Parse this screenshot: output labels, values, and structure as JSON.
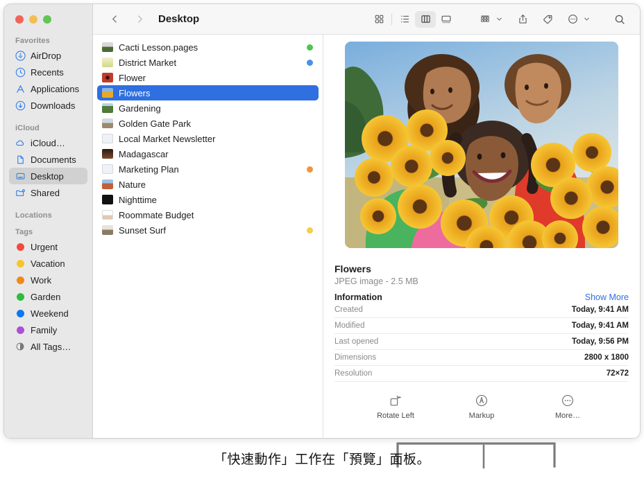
{
  "window": {
    "title": "Desktop",
    "traffic_lights": [
      "close-red",
      "minimize-yellow",
      "zoom-green"
    ]
  },
  "toolbar": {
    "back_icon": "chevron-left-icon",
    "forward_icon": "chevron-right-icon",
    "view_icon_grid": "icon-view-icon",
    "view_list": "list-view-icon",
    "view_columns": "column-view-icon",
    "view_gallery": "gallery-view-icon",
    "group_icon": "group-by-icon",
    "share_icon": "share-icon",
    "tag_icon": "tag-icon",
    "more_icon": "more-circle-icon",
    "search_icon": "search-icon",
    "active_view": "column-view-icon"
  },
  "sidebar": {
    "groups": [
      {
        "title": "Favorites",
        "items": [
          {
            "label": "AirDrop",
            "icon": "airdrop-icon"
          },
          {
            "label": "Recents",
            "icon": "clock-icon"
          },
          {
            "label": "Applications",
            "icon": "applications-icon"
          },
          {
            "label": "Downloads",
            "icon": "download-icon"
          }
        ]
      },
      {
        "title": "iCloud",
        "items": [
          {
            "label": "iCloud…",
            "icon": "cloud-icon"
          },
          {
            "label": "Documents",
            "icon": "document-icon"
          },
          {
            "label": "Desktop",
            "icon": "desktop-icon",
            "selected": true
          },
          {
            "label": "Shared",
            "icon": "shared-folder-icon"
          }
        ]
      },
      {
        "title": "Locations",
        "items": []
      },
      {
        "title": "Tags",
        "items": [
          {
            "label": "Urgent",
            "icon": "tag-dot-icon",
            "color": "#f5483f"
          },
          {
            "label": "Vacation",
            "icon": "tag-dot-icon",
            "color": "#f6c52c"
          },
          {
            "label": "Work",
            "icon": "tag-dot-icon",
            "color": "#f08a18"
          },
          {
            "label": "Garden",
            "icon": "tag-dot-icon",
            "color": "#2dbd3e"
          },
          {
            "label": "Weekend",
            "icon": "tag-dot-icon",
            "color": "#0b77f5"
          },
          {
            "label": "Family",
            "icon": "tag-dot-icon",
            "color": "#ad4fd6"
          },
          {
            "label": "All Tags…",
            "icon": "all-tags-icon",
            "color": ""
          }
        ]
      }
    ]
  },
  "filelist": {
    "items": [
      {
        "name": "Cacti Lesson.pages",
        "tag": "#49c84a",
        "selected": false
      },
      {
        "name": "District Market",
        "tag": "#4a90e8",
        "selected": false
      },
      {
        "name": "Flower",
        "tag": "",
        "selected": false
      },
      {
        "name": "Flowers",
        "tag": "",
        "selected": true
      },
      {
        "name": "Gardening",
        "tag": "",
        "selected": false
      },
      {
        "name": "Golden Gate Park",
        "tag": "",
        "selected": false
      },
      {
        "name": "Local Market Newsletter",
        "tag": "",
        "selected": false
      },
      {
        "name": "Madagascar",
        "tag": "",
        "selected": false
      },
      {
        "name": "Marketing Plan",
        "tag": "#f0953a",
        "selected": false
      },
      {
        "name": "Nature",
        "tag": "",
        "selected": false
      },
      {
        "name": "Nighttime",
        "tag": "",
        "selected": false
      },
      {
        "name": "Roommate Budget",
        "tag": "",
        "selected": false
      },
      {
        "name": "Sunset Surf",
        "tag": "#f4cf4a",
        "selected": false
      }
    ]
  },
  "preview": {
    "photo_alt": "three-people-holding-sunflower-bouquets",
    "file_title": "Flowers",
    "file_subtitle": "JPEG image - 2.5 MB",
    "information_label": "Information",
    "show_more_label": "Show More",
    "rows": [
      {
        "key": "Created",
        "value": "Today, 9:41 AM"
      },
      {
        "key": "Modified",
        "value": "Today, 9:41 AM"
      },
      {
        "key": "Last opened",
        "value": "Today, 9:56 PM"
      },
      {
        "key": "Dimensions",
        "value": "2800 x 1800"
      },
      {
        "key": "Resolution",
        "value": "72×72"
      }
    ],
    "quick_actions": [
      {
        "label": "Rotate Left",
        "icon": "rotate-left-icon"
      },
      {
        "label": "Markup",
        "icon": "markup-icon"
      },
      {
        "label": "More…",
        "icon": "more-circle-icon"
      }
    ]
  },
  "caption": {
    "text": "「快速動作」工作在「預覽」面板。"
  },
  "colors": {
    "accent": "#2f6fe0",
    "selection": "#2f6fe0",
    "sidebar_bg": "#e9e8e8",
    "toolbar_bg": "#f7f7f7",
    "link": "#2f6fe0"
  }
}
